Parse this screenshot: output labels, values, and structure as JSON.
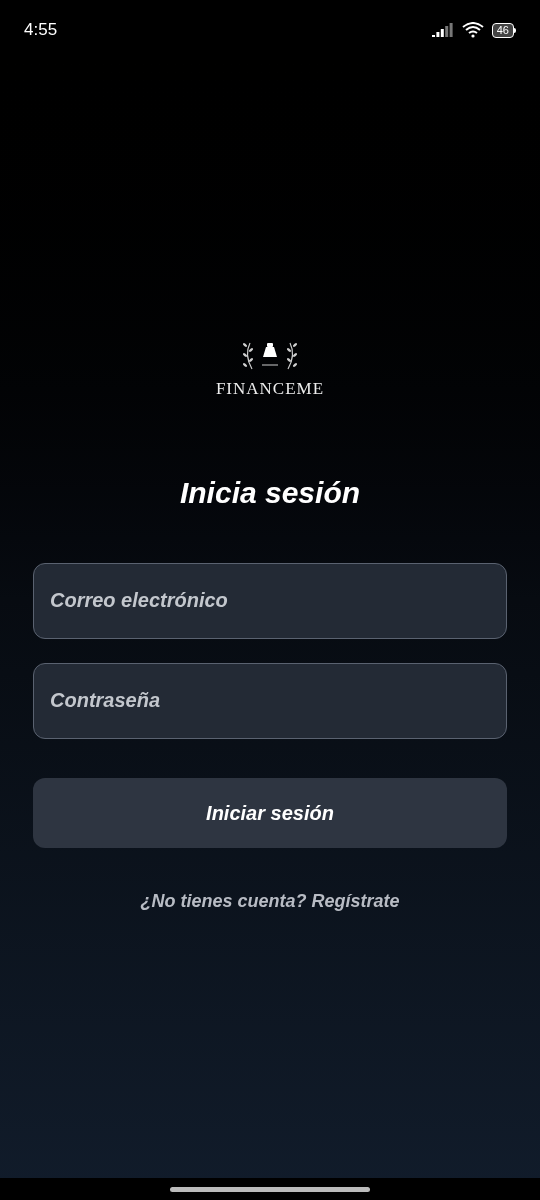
{
  "status_bar": {
    "time": "4:55",
    "battery": "46"
  },
  "logo": {
    "name": "FINANCEME"
  },
  "title": "Inicia sesión",
  "fields": [
    {
      "placeholder": "Correo electrónico"
    },
    {
      "placeholder": "Contraseña"
    }
  ],
  "submit_button": "Iniciar sesión",
  "register_link": "¿No tienes cuenta? Regístrate"
}
